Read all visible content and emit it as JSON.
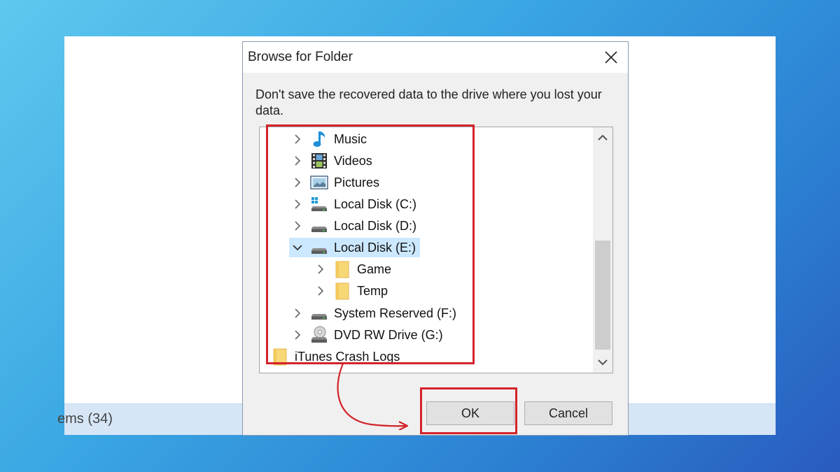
{
  "background_window": {
    "status_text": "ems (34)"
  },
  "dialog": {
    "title": "Browse for Folder",
    "close_icon": "close-icon",
    "instruction": "Don't save the recovered data to the drive where you lost your data.",
    "tree_items": [
      {
        "label": "Music",
        "icon": "music-icon",
        "expander": "collapsed",
        "level": 1
      },
      {
        "label": "Videos",
        "icon": "videos-icon",
        "expander": "collapsed",
        "level": 1
      },
      {
        "label": "Pictures",
        "icon": "pictures-icon",
        "expander": "collapsed",
        "level": 1
      },
      {
        "label": "Local Disk (C:)",
        "icon": "system-drive-icon",
        "expander": "collapsed",
        "level": 1
      },
      {
        "label": "Local Disk (D:)",
        "icon": "drive-icon",
        "expander": "collapsed",
        "level": 1
      },
      {
        "label": "Local Disk (E:)",
        "icon": "drive-icon",
        "expander": "expanded",
        "level": 1,
        "selected": true
      },
      {
        "label": "Game",
        "icon": "folder-icon",
        "expander": "collapsed",
        "level": 2
      },
      {
        "label": "Temp",
        "icon": "folder-icon",
        "expander": "collapsed",
        "level": 2
      },
      {
        "label": "System Reserved (F:)",
        "icon": "drive-icon",
        "expander": "collapsed",
        "level": 1
      },
      {
        "label": "DVD RW Drive (G:)",
        "icon": "dvd-drive-icon",
        "expander": "collapsed",
        "level": 1
      },
      {
        "label": "iTunes Crash Logs",
        "icon": "folder-icon",
        "expander": "none",
        "level": 0
      }
    ],
    "buttons": {
      "ok": "OK",
      "cancel": "Cancel"
    }
  },
  "annotations": {
    "highlight_color": "#d3232a"
  },
  "colors": {
    "selection": "#cce8ff",
    "folder": "#f8d775",
    "dialog_background": "#f0f0f0"
  }
}
